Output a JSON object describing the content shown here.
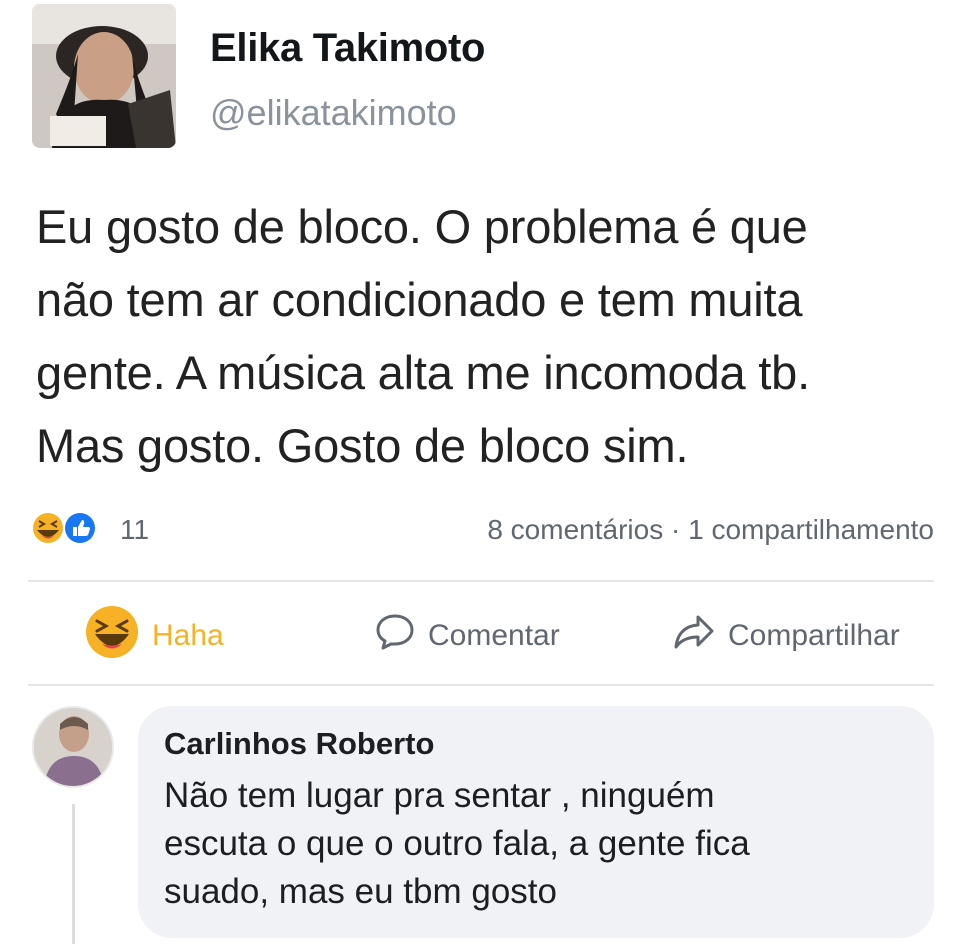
{
  "author": {
    "name": "Elika Takimoto",
    "handle": "@elikatakimoto"
  },
  "post": {
    "lines": [
      "Eu gosto de bloco. O problema é que",
      "não tem ar condicionado e tem muita",
      "gente. A música alta me incomoda tb.",
      "Mas gosto. Gosto de bloco sim."
    ]
  },
  "stats": {
    "reaction_icons": [
      "haha-reaction-icon",
      "like-reaction-icon"
    ],
    "reaction_count": "11",
    "comments": "8 comentários",
    "separator": "·",
    "shares": "1 compartilhamento"
  },
  "actions": {
    "haha_label": "Haha",
    "comment_label": "Comentar",
    "share_label": "Compartilhar"
  },
  "comment": {
    "author": "Carlinhos Roberto",
    "lines": [
      "Não tem lugar pra sentar , ninguém",
      "escuta o que o outro fala, a gente fica",
      "suado, mas eu tbm gosto"
    ]
  },
  "colors": {
    "haha_active": "#f7b125",
    "like_blue": "#1877f2",
    "secondary_text": "#606770",
    "handle_gray": "#8a939b",
    "comment_bubble": "#f0f2f5"
  }
}
